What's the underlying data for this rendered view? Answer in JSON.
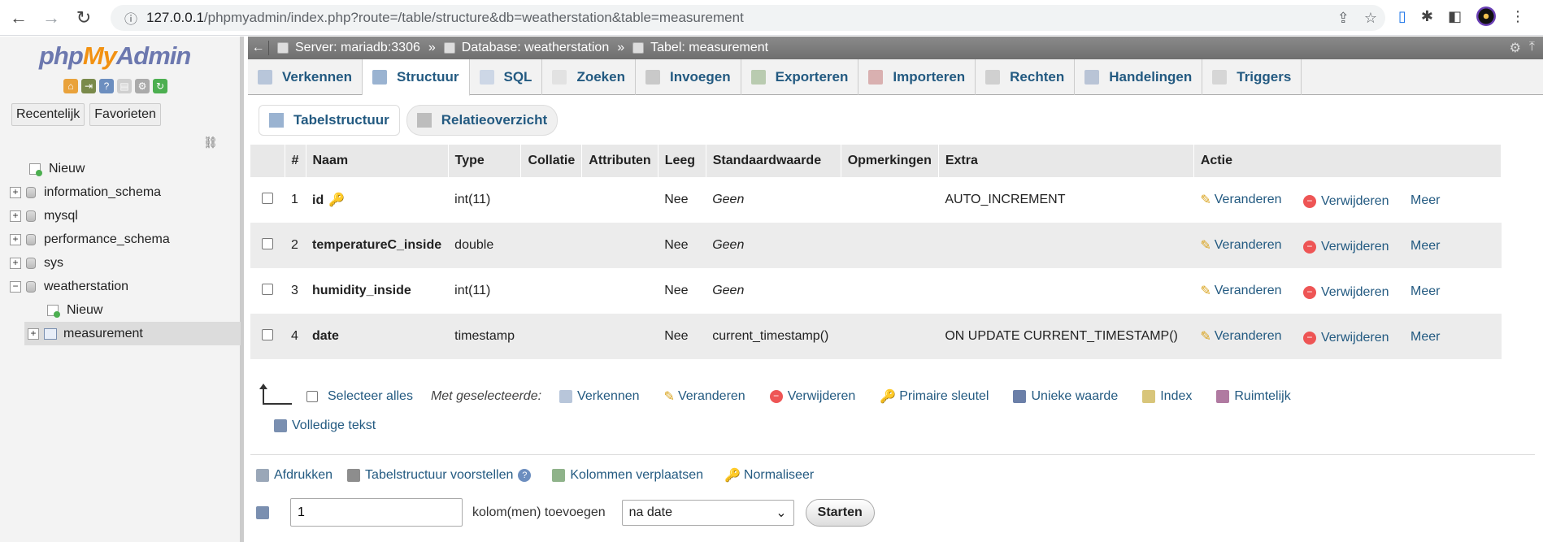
{
  "browser": {
    "url_host": "127.0.0.1",
    "url_rest": "/phpmyadmin/index.php?route=/table/structure&db=weatherstation&table=measurement"
  },
  "nav": {
    "logo_php": "php",
    "logo_my": "My",
    "logo_admin": "Admin",
    "recent": "Recentelijk",
    "favorites": "Favorieten",
    "tree": {
      "new": "Nieuw",
      "dbs": [
        "information_schema",
        "mysql",
        "performance_schema",
        "sys"
      ],
      "active_db": "weatherstation",
      "child_new": "Nieuw",
      "child_table": "measurement"
    }
  },
  "breadcrumb": {
    "server": "Server: mariadb:3306",
    "database": "Database: weatherstation",
    "table": "Tabel: measurement",
    "sep": "»"
  },
  "tabs": [
    "Verkennen",
    "Structuur",
    "SQL",
    "Zoeken",
    "Invoegen",
    "Exporteren",
    "Importeren",
    "Rechten",
    "Handelingen",
    "Triggers"
  ],
  "subtabs": [
    "Tabelstructuur",
    "Relatieoverzicht"
  ],
  "columns": [
    "#",
    "Naam",
    "Type",
    "Collatie",
    "Attributen",
    "Leeg",
    "Standaardwaarde",
    "Opmerkingen",
    "Extra",
    "Actie"
  ],
  "rows": [
    {
      "num": "1",
      "name": "id",
      "type": "int(11)",
      "null": "Nee",
      "default": "Geen",
      "extra": "AUTO_INCREMENT"
    },
    {
      "num": "2",
      "name": "temperatureC_inside",
      "type": "double",
      "null": "Nee",
      "default": "Geen",
      "extra": ""
    },
    {
      "num": "3",
      "name": "humidity_inside",
      "type": "int(11)",
      "null": "Nee",
      "default": "Geen",
      "extra": ""
    },
    {
      "num": "4",
      "name": "date",
      "type": "timestamp",
      "null": "Nee",
      "default": "current_timestamp()",
      "extra": "ON UPDATE CURRENT_TIMESTAMP()"
    }
  ],
  "actions": {
    "change": "Veranderen",
    "drop": "Verwijderen",
    "more": "Meer"
  },
  "bulk": {
    "select_all": "Selecteer alles",
    "with_selected": "Met geselecteerde:",
    "items": [
      "Verkennen",
      "Veranderen",
      "Verwijderen",
      "Primaire sleutel",
      "Unieke waarde",
      "Index",
      "Ruimtelijk"
    ],
    "fulltext": "Volledige tekst"
  },
  "bottom": {
    "print": "Afdrukken",
    "propose": "Tabelstructuur voorstellen",
    "move": "Kolommen verplaatsen",
    "normalize": "Normaliseer"
  },
  "add": {
    "count": "1",
    "label": "kolom(men) toevoegen",
    "position": "na date",
    "go": "Starten"
  },
  "colors": {
    "link": "#235a81",
    "accent": "#f29111"
  }
}
